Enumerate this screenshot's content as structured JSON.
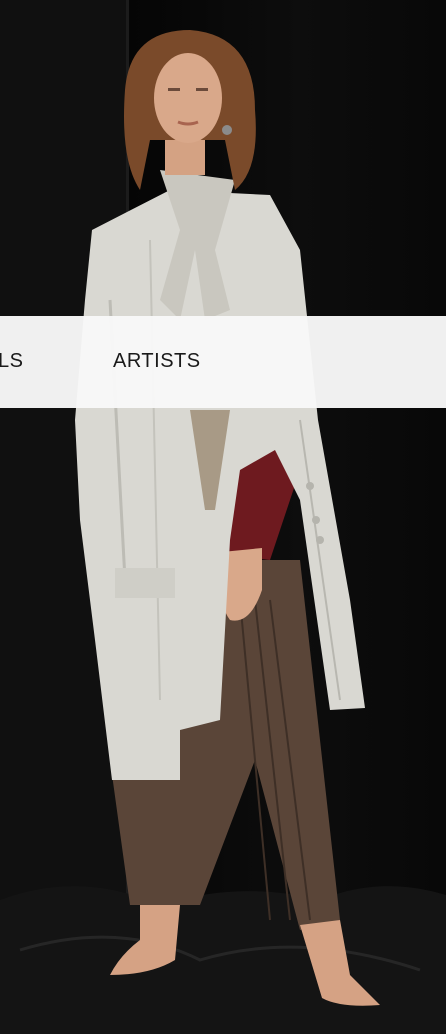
{
  "nav": {
    "items": [
      {
        "label": "LS"
      },
      {
        "label": "ARTISTS"
      }
    ]
  },
  "hero": {
    "icon": "fashion-photo-model"
  },
  "colors": {
    "background": "#0a0a0a",
    "nav_band": "#f8f8f8",
    "nav_text": "#1a1a1a",
    "coat": "#d9d8d2",
    "sweater": "#6e1a1f",
    "trousers": "#5a4538",
    "hair": "#7a4a2a",
    "skin": "#d9a88a"
  }
}
